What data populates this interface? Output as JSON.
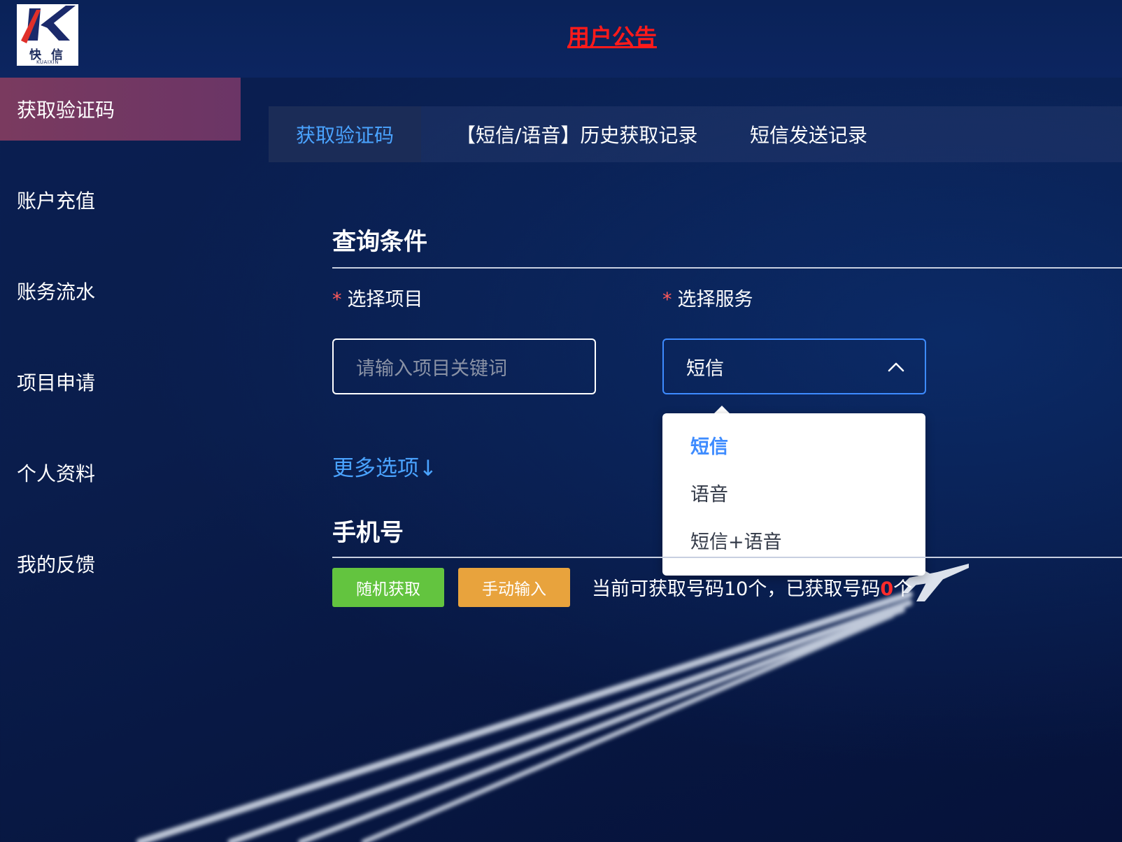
{
  "header": {
    "logo": {
      "text": "快 信",
      "sub": "KUAIXIN"
    },
    "notice": "用户公告"
  },
  "sidebar": {
    "items": [
      {
        "label": "获取验证码",
        "active": true
      },
      {
        "label": "账户充值"
      },
      {
        "label": "账务流水"
      },
      {
        "label": "项目申请"
      },
      {
        "label": "个人资料"
      },
      {
        "label": "我的反馈"
      }
    ]
  },
  "tabs": [
    {
      "label": "获取验证码",
      "active": true
    },
    {
      "label": "【短信/语音】历史获取记录"
    },
    {
      "label": "短信发送记录"
    }
  ],
  "query": {
    "title": "查询条件",
    "project_label": "选择项目",
    "project_placeholder": "请输入项目关键词",
    "service_label": "选择服务",
    "service_value": "短信",
    "required_mark": "*",
    "service_options": [
      "短信",
      "语音",
      "短信+语音"
    ],
    "more_options": "更多选项↓"
  },
  "phone": {
    "title": "手机号",
    "random_button": "随机获取",
    "manual_button": "手动输入",
    "status_prefix": "当前可获取号码10个，已获取号码",
    "status_obtained": "0",
    "status_suffix": "个"
  },
  "colors": {
    "accent": "#3d8bff",
    "active_sidebar": "#7a3a5f",
    "notice": "#ff1a1a",
    "green": "#63c43f",
    "orange": "#e8a33d"
  }
}
